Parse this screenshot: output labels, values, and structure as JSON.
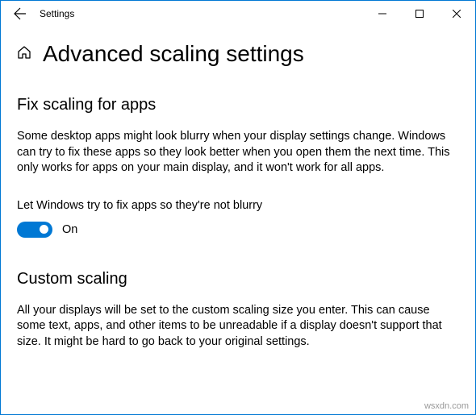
{
  "window": {
    "title": "Settings"
  },
  "page": {
    "title": "Advanced scaling settings"
  },
  "section1": {
    "title": "Fix scaling for apps",
    "body": "Some desktop apps might look blurry when your display settings change. Windows can try to fix these apps so they look better when you open them the next time. This only works for apps on your main display, and it won't work for all apps.",
    "toggle_label": "Let Windows try to fix apps so they're not blurry",
    "toggle_state": "On"
  },
  "section2": {
    "title": "Custom scaling",
    "body": "All your displays will be set to the custom scaling size you enter. This can cause some text, apps, and other items to be unreadable if a display doesn't support that size. It might be hard to go back to your original settings."
  },
  "watermark": "wsxdn.com"
}
